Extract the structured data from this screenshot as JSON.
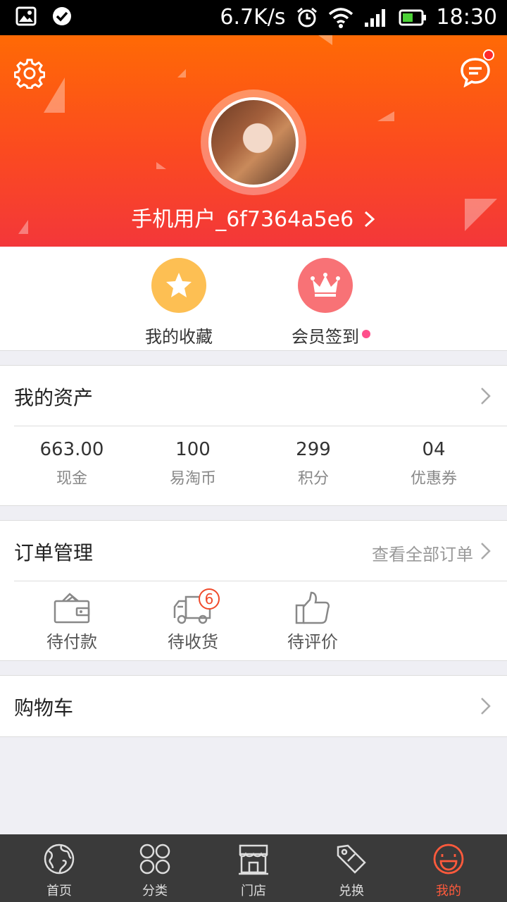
{
  "status_bar": {
    "speed": "6.7K/s",
    "time": "18:30"
  },
  "header": {
    "username": "手机用户_6f7364a5e6",
    "username_chevron": ">"
  },
  "quick_actions": [
    {
      "label": "我的收藏",
      "icon": "star-icon",
      "color": "#fdbf53"
    },
    {
      "label": "会员签到",
      "icon": "crown-icon",
      "color": "#f87276"
    }
  ],
  "assets": {
    "title": "我的资产",
    "items": [
      {
        "value": "663.00",
        "label": "现金"
      },
      {
        "value": "100",
        "label": "易淘币"
      },
      {
        "value": "299",
        "label": "积分"
      },
      {
        "value": "04",
        "label": "优惠券"
      }
    ]
  },
  "orders": {
    "title": "订单管理",
    "link": "查看全部订单",
    "items": [
      {
        "label": "待付款",
        "icon": "wallet-icon"
      },
      {
        "label": "待收货",
        "icon": "truck-icon",
        "badge": "6"
      },
      {
        "label": "待评价",
        "icon": "thumbs-up-icon"
      }
    ]
  },
  "cart": {
    "title": "购物车"
  },
  "tabs": [
    {
      "label": "首页",
      "icon": "globe-icon"
    },
    {
      "label": "分类",
      "icon": "grid-icon"
    },
    {
      "label": "门店",
      "icon": "store-icon"
    },
    {
      "label": "兑换",
      "icon": "tag-icon"
    },
    {
      "label": "我的",
      "icon": "smile-icon",
      "active": true
    }
  ],
  "colors": {
    "accent": "#ff5a3c",
    "header_top": "#ff6a05",
    "header_bottom": "#f3373a"
  }
}
